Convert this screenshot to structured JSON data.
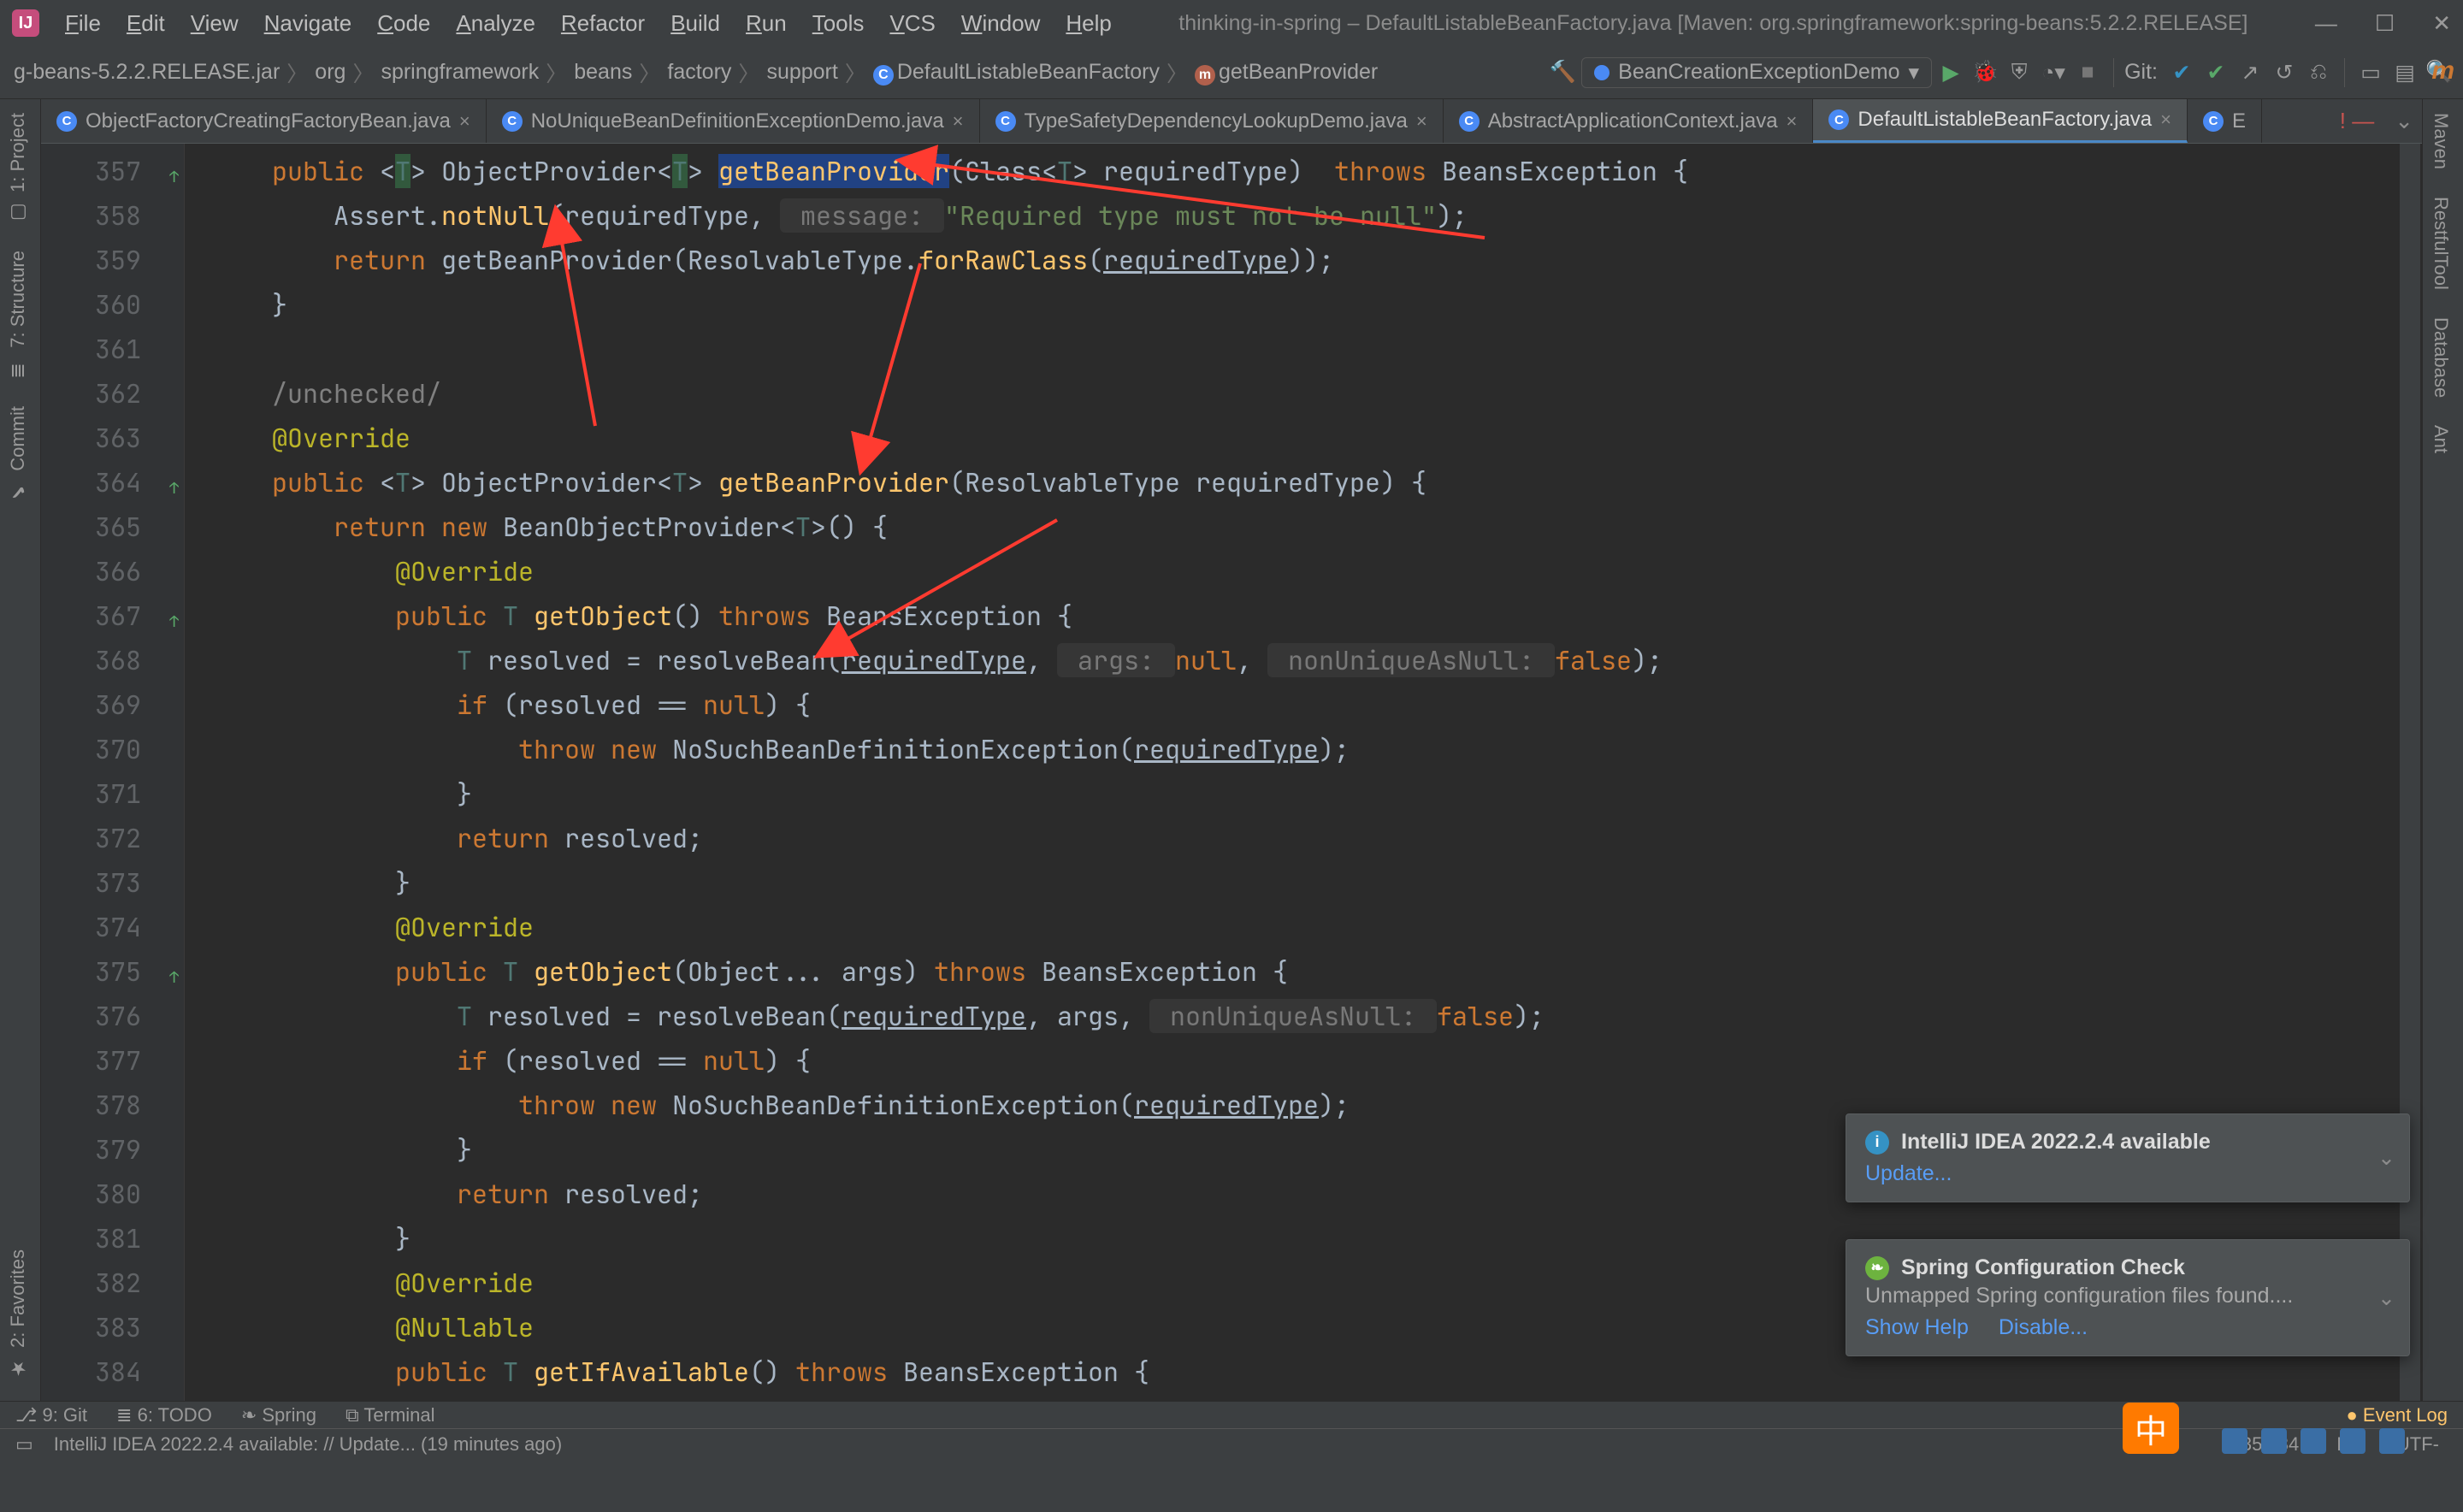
{
  "window": {
    "title": "thinking-in-spring – DefaultListableBeanFactory.java [Maven: org.springframework:spring-beans:5.2.2.RELEASE]"
  },
  "menus": [
    "File",
    "Edit",
    "View",
    "Navigate",
    "Code",
    "Analyze",
    "Refactor",
    "Build",
    "Run",
    "Tools",
    "VCS",
    "Window",
    "Help"
  ],
  "breadcrumb": {
    "items": [
      {
        "label": "g-beans-5.2.2.RELEASE.jar"
      },
      {
        "label": "org"
      },
      {
        "label": "springframework"
      },
      {
        "label": "beans"
      },
      {
        "label": "factory"
      },
      {
        "label": "support"
      },
      {
        "label": "DefaultListableBeanFactory",
        "ico": "c-c",
        "glyph": "C"
      },
      {
        "label": "getBeanProvider",
        "ico": "c-m",
        "glyph": "m"
      }
    ]
  },
  "runconfig": {
    "name": "BeanCreationExceptionDemo"
  },
  "git": {
    "label": "Git:"
  },
  "tabs": [
    {
      "label": "ObjectFactoryCreatingFactoryBean.java"
    },
    {
      "label": "NoUniqueBeanDefinitionExceptionDemo.java"
    },
    {
      "label": "TypeSafetyDependencyLookupDemo.java"
    },
    {
      "label": "AbstractApplicationContext.java"
    },
    {
      "label": "DefaultListableBeanFactory.java",
      "active": true
    },
    {
      "label": "E",
      "trunc": true
    }
  ],
  "leftTools": {
    "a": "1: Project",
    "b": "7: Structure",
    "c": "Commit",
    "d": "2: Favorites"
  },
  "rightTools": {
    "a": "Maven",
    "b": "RestfulTool",
    "c": "Database",
    "d": "Ant",
    "e": "m"
  },
  "gutter": {
    "start": 357,
    "end": 384,
    "marks": {
      "357": "ovgu",
      "364": "ovgu",
      "367": "ovgu",
      "375": "ovgu"
    }
  },
  "lines": {
    "357": [
      {
        "t": "    ",
        "c": ""
      },
      {
        "t": "public ",
        "c": "kw"
      },
      {
        "t": "<",
        "c": "id"
      },
      {
        "t": "T",
        "c": "gen match"
      },
      {
        "t": "> ",
        "c": "id"
      },
      {
        "t": "ObjectProvider<",
        "c": "id"
      },
      {
        "t": "T",
        "c": "gen match"
      },
      {
        "t": "> ",
        "c": "id"
      },
      {
        "t": "getBeanProvider",
        "c": "fn caretword"
      },
      {
        "t": "(Class<",
        "c": "id"
      },
      {
        "t": "T",
        "c": "gen"
      },
      {
        "t": "> requiredType)  ",
        "c": "id"
      },
      {
        "t": "throws ",
        "c": "kw"
      },
      {
        "t": "BeansException {",
        "c": "id"
      }
    ],
    "358": [
      {
        "t": "        Assert.",
        "c": "id"
      },
      {
        "t": "notNull",
        "c": "fn"
      },
      {
        "t": "(requiredType, ",
        "c": "id"
      },
      {
        "t": " message: ",
        "c": "hint"
      },
      {
        "t": "\"Required type must not be null\"",
        "c": "str"
      },
      {
        "t": ");",
        "c": "id"
      }
    ],
    "359": [
      {
        "t": "        ",
        "c": ""
      },
      {
        "t": "return ",
        "c": "kw"
      },
      {
        "t": "getBeanProvider(ResolvableType.",
        "c": "id"
      },
      {
        "t": "forRawClass",
        "c": "fn"
      },
      {
        "t": "(",
        "c": "id"
      },
      {
        "t": "requiredType",
        "c": "id ul"
      },
      {
        "t": "));",
        "c": "id"
      }
    ],
    "360": [
      {
        "t": "    }",
        "c": "id"
      }
    ],
    "361": [
      {
        "t": "",
        "c": ""
      }
    ],
    "362": [
      {
        "t": "    /unchecked/",
        "c": "cmt"
      }
    ],
    "363": [
      {
        "t": "    ",
        "c": ""
      },
      {
        "t": "@Override",
        "c": "ann"
      }
    ],
    "364": [
      {
        "t": "    ",
        "c": ""
      },
      {
        "t": "public ",
        "c": "kw"
      },
      {
        "t": "<",
        "c": "id"
      },
      {
        "t": "T",
        "c": "gen"
      },
      {
        "t": "> ObjectProvider<",
        "c": "id"
      },
      {
        "t": "T",
        "c": "gen"
      },
      {
        "t": "> ",
        "c": "id"
      },
      {
        "t": "getBeanProvider",
        "c": "fn"
      },
      {
        "t": "(ResolvableType requiredType) {",
        "c": "id"
      }
    ],
    "365": [
      {
        "t": "        ",
        "c": ""
      },
      {
        "t": "return new ",
        "c": "kw"
      },
      {
        "t": "BeanObjectProvider<",
        "c": "id"
      },
      {
        "t": "T",
        "c": "gen"
      },
      {
        "t": ">() {",
        "c": "id"
      }
    ],
    "366": [
      {
        "t": "            ",
        "c": ""
      },
      {
        "t": "@Override",
        "c": "ann"
      }
    ],
    "367": [
      {
        "t": "            ",
        "c": ""
      },
      {
        "t": "public ",
        "c": "kw"
      },
      {
        "t": "T ",
        "c": "gen"
      },
      {
        "t": "getObject",
        "c": "fn"
      },
      {
        "t": "() ",
        "c": "id"
      },
      {
        "t": "throws ",
        "c": "kw"
      },
      {
        "t": "BeansException {",
        "c": "id"
      }
    ],
    "368": [
      {
        "t": "                ",
        "c": ""
      },
      {
        "t": "T ",
        "c": "gen"
      },
      {
        "t": "resolved = resolveBean(",
        "c": "id"
      },
      {
        "t": "requiredType",
        "c": "id ul"
      },
      {
        "t": ", ",
        "c": "id"
      },
      {
        "t": " args: ",
        "c": "hint"
      },
      {
        "t": "null",
        "c": "nul"
      },
      {
        "t": ", ",
        "c": "id"
      },
      {
        "t": " nonUniqueAsNull: ",
        "c": "hint"
      },
      {
        "t": "false",
        "c": "kw"
      },
      {
        "t": ");",
        "c": "id"
      }
    ],
    "369": [
      {
        "t": "                ",
        "c": ""
      },
      {
        "t": "if ",
        "c": "kw"
      },
      {
        "t": "(resolved == ",
        "c": "id"
      },
      {
        "t": "null",
        "c": "nul"
      },
      {
        "t": ") {",
        "c": "id"
      }
    ],
    "370": [
      {
        "t": "                    ",
        "c": ""
      },
      {
        "t": "throw new ",
        "c": "kw"
      },
      {
        "t": "NoSuchBeanDefinitionException(",
        "c": "id"
      },
      {
        "t": "requiredType",
        "c": "id ul"
      },
      {
        "t": ");",
        "c": "id"
      }
    ],
    "371": [
      {
        "t": "                }",
        "c": "id"
      }
    ],
    "372": [
      {
        "t": "                ",
        "c": ""
      },
      {
        "t": "return ",
        "c": "kw"
      },
      {
        "t": "resolved;",
        "c": "id"
      }
    ],
    "373": [
      {
        "t": "            }",
        "c": "id"
      }
    ],
    "374": [
      {
        "t": "            ",
        "c": ""
      },
      {
        "t": "@Override",
        "c": "ann"
      }
    ],
    "375": [
      {
        "t": "            ",
        "c": ""
      },
      {
        "t": "public ",
        "c": "kw"
      },
      {
        "t": "T ",
        "c": "gen"
      },
      {
        "t": "getObject",
        "c": "fn"
      },
      {
        "t": "(Object... args) ",
        "c": "id"
      },
      {
        "t": "throws ",
        "c": "kw"
      },
      {
        "t": "BeansException {",
        "c": "id"
      }
    ],
    "376": [
      {
        "t": "                ",
        "c": ""
      },
      {
        "t": "T ",
        "c": "gen"
      },
      {
        "t": "resolved = resolveBean(",
        "c": "id"
      },
      {
        "t": "requiredType",
        "c": "id ul"
      },
      {
        "t": ", args, ",
        "c": "id"
      },
      {
        "t": " nonUniqueAsNull: ",
        "c": "hint"
      },
      {
        "t": "false",
        "c": "kw"
      },
      {
        "t": ");",
        "c": "id"
      }
    ],
    "377": [
      {
        "t": "                ",
        "c": ""
      },
      {
        "t": "if ",
        "c": "kw"
      },
      {
        "t": "(resolved == ",
        "c": "id"
      },
      {
        "t": "null",
        "c": "nul"
      },
      {
        "t": ") {",
        "c": "id"
      }
    ],
    "378": [
      {
        "t": "                    ",
        "c": ""
      },
      {
        "t": "throw new ",
        "c": "kw"
      },
      {
        "t": "NoSuchBeanDefinitionException(",
        "c": "id"
      },
      {
        "t": "requiredType",
        "c": "id ul"
      },
      {
        "t": ");",
        "c": "id"
      }
    ],
    "379": [
      {
        "t": "                }",
        "c": "id"
      }
    ],
    "380": [
      {
        "t": "                ",
        "c": ""
      },
      {
        "t": "return ",
        "c": "kw"
      },
      {
        "t": "resolved;",
        "c": "id"
      }
    ],
    "381": [
      {
        "t": "            }",
        "c": "id"
      }
    ],
    "382": [
      {
        "t": "            ",
        "c": ""
      },
      {
        "t": "@Override",
        "c": "ann"
      }
    ],
    "383": [
      {
        "t": "            ",
        "c": ""
      },
      {
        "t": "@Nullable",
        "c": "ann"
      }
    ],
    "384": [
      {
        "t": "            ",
        "c": ""
      },
      {
        "t": "public ",
        "c": "kw"
      },
      {
        "t": "T ",
        "c": "gen"
      },
      {
        "t": "getIfAvailable",
        "c": "fn"
      },
      {
        "t": "() ",
        "c": "id"
      },
      {
        "t": "throws ",
        "c": "kw"
      },
      {
        "t": "BeansException {",
        "c": "id"
      }
    ]
  },
  "bottomTools": {
    "a": "9: Git",
    "b": "6: TODO",
    "c": "Spring",
    "d": "Terminal",
    "ev": "Event Log"
  },
  "status": {
    "msg": "IntelliJ IDEA 2022.2.4 available: // Update... (19 minutes ago)",
    "pos": "357:34",
    "lf": "LF",
    "enc": "UTF-"
  },
  "notif1": {
    "title": "IntelliJ IDEA 2022.2.4 available",
    "link": "Update..."
  },
  "notif2": {
    "title": "Spring Configuration Check",
    "body": "Unmapped Spring configuration files found....",
    "link1": "Show Help",
    "link2": "Disable..."
  },
  "ime": "中"
}
